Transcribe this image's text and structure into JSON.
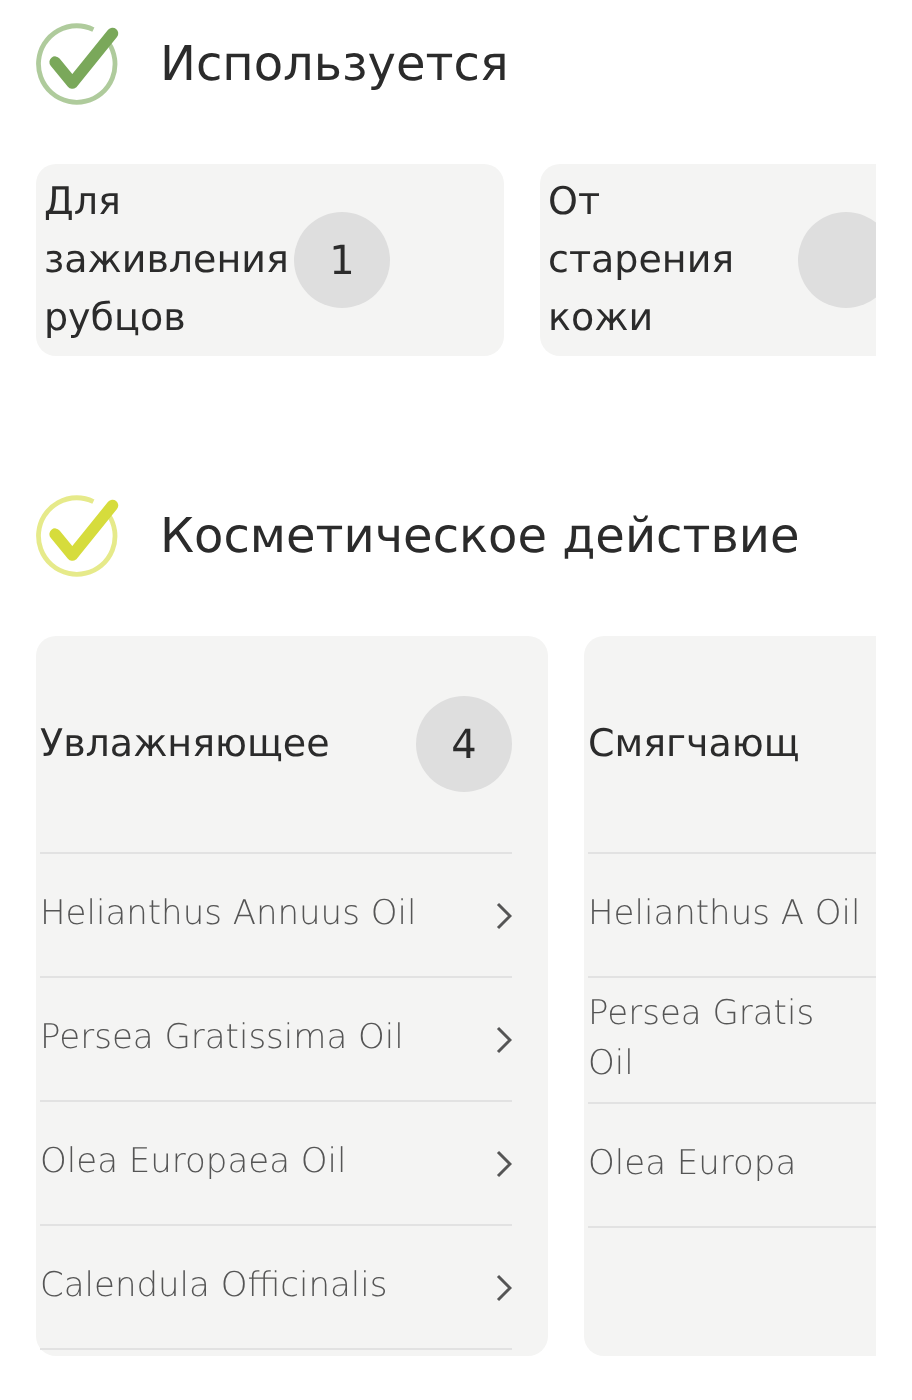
{
  "sections": [
    {
      "title": "Используется",
      "color": "#7aa85a",
      "kind": "compact",
      "cards": [
        {
          "title": "Для заживления рубцов",
          "count": "1"
        },
        {
          "title": "От старения кожи"
        }
      ]
    },
    {
      "title": "Косметическое действие",
      "color": "#d6dc3c",
      "kind": "list",
      "cards": [
        {
          "title": "Увлажняющее",
          "count": "4",
          "items": [
            "Helianthus Annuus Oil",
            "Persea Gratissima Oil",
            "Olea Europaea Oil",
            "Calendula Officinalis"
          ]
        },
        {
          "title": "Смягчающ",
          "items": [
            "Helianthus A Oil",
            "Persea Gratis Oil",
            "Olea Europa"
          ]
        }
      ]
    }
  ]
}
